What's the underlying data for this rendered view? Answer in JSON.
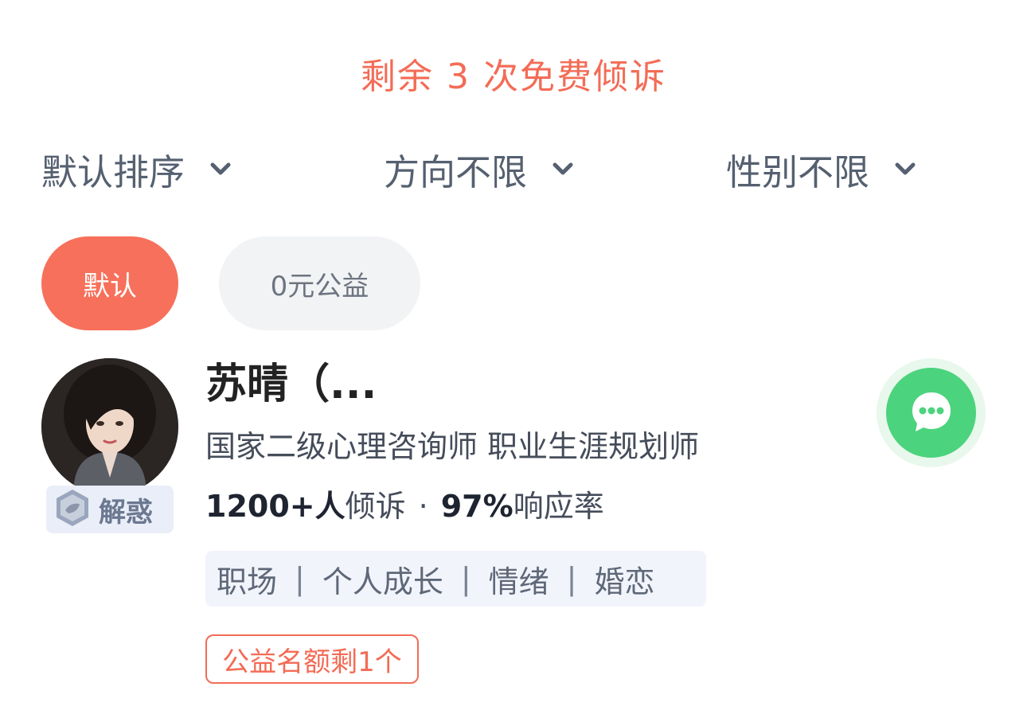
{
  "banner": {
    "remaining_text": "剩余 3 次免费倾诉"
  },
  "filters": {
    "sort": {
      "label": "默认排序",
      "icon": "chevron-down-icon"
    },
    "direction": {
      "label": "方向不限",
      "icon": "chevron-down-icon"
    },
    "gender": {
      "label": "性别不限",
      "icon": "chevron-down-icon"
    }
  },
  "pills": {
    "default": "默认",
    "charity": "0元公益"
  },
  "counselor": {
    "name": "苏晴（...",
    "titles": "国家二级心理咨询师 职业生涯规划师",
    "stats": {
      "count": "1200+人",
      "count_suffix": "倾诉",
      "separator": "·",
      "rate": "97%",
      "rate_suffix": "响应率"
    },
    "badge": {
      "label": "解惑",
      "icon": "hexagon-badge-icon"
    },
    "tags": [
      "职场",
      "个人成长",
      "情绪",
      "婚恋"
    ],
    "tag_separator": "|",
    "quota": "公益名额剩1个",
    "chat_icon": "chat-bubble-icon"
  },
  "colors": {
    "accent": "#f36c56",
    "pill_active": "#f7705b",
    "chat_green": "#4cd37d",
    "text_primary": "#222222",
    "text_secondary": "#556070"
  }
}
